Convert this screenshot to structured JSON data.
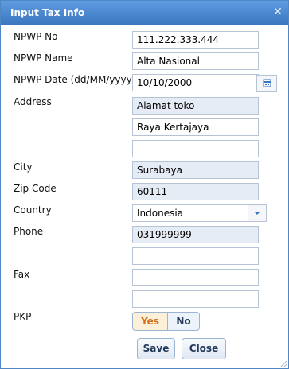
{
  "window": {
    "title": "Input Tax Info"
  },
  "labels": {
    "npwp_no": "NPWP No",
    "npwp_name": "NPWP Name",
    "npwp_date": "NPWP Date (dd/MM/yyyy)",
    "address": "Address",
    "city": "City",
    "zip": "Zip Code",
    "country": "Country",
    "phone": "Phone",
    "fax": "Fax",
    "pkp": "PKP"
  },
  "fields": {
    "npwp_no": "111.222.333.444",
    "npwp_name": "Alta Nasional",
    "npwp_date": "10/10/2000",
    "address_1": "Alamat toko",
    "address_2": "Raya Kertajaya",
    "address_3": "",
    "city": "Surabaya",
    "zip": "60111",
    "country": "Indonesia",
    "phone_1": "031999999",
    "phone_2": "",
    "fax_1": "",
    "fax_2": ""
  },
  "pkp": {
    "yes_label": "Yes",
    "no_label": "No",
    "selected": "Yes"
  },
  "buttons": {
    "save": "Save",
    "close": "Close"
  },
  "icons": {
    "close": "close-icon",
    "calendar": "calendar-icon",
    "dropdown": "chevron-down-icon"
  },
  "colors": {
    "title_bar": "#4a86cc",
    "readonly_field": "#e6ecf5",
    "selected_toggle_text": "#d0701c"
  }
}
